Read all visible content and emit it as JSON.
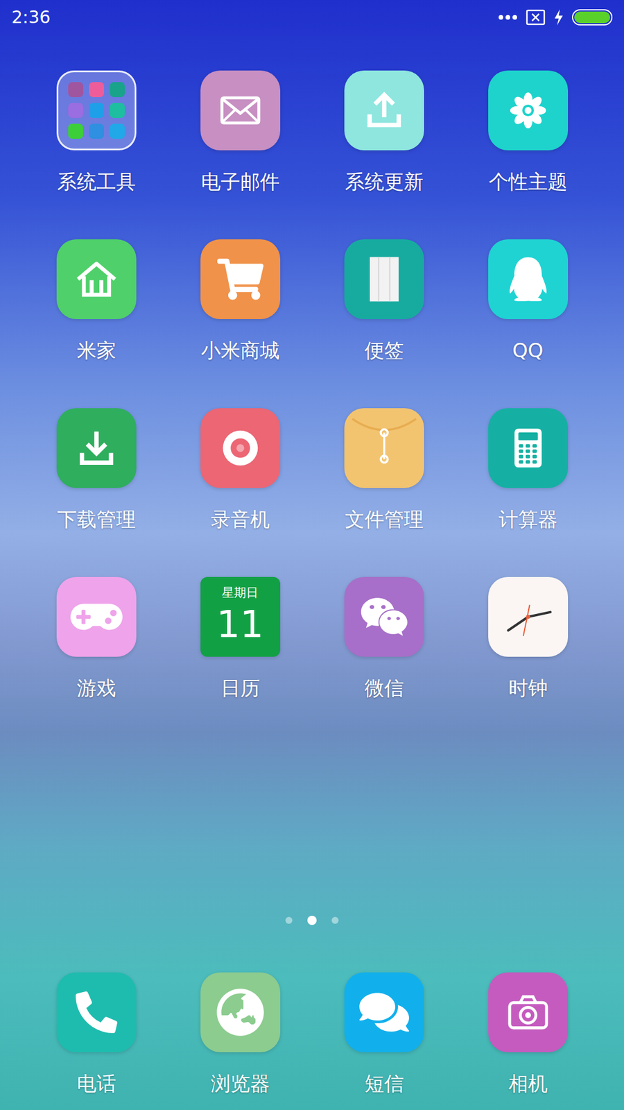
{
  "status_bar": {
    "time": "2:36",
    "battery": {
      "level": 1,
      "charging": true
    }
  },
  "apps": [
    {
      "label": "系统工具",
      "kind": "folder",
      "color": "#ffffff",
      "items": [
        {
          "color": "#a0559f"
        },
        {
          "color": "#ee5d9a"
        },
        {
          "color": "#19a38b"
        },
        {
          "color": "#9a6de0"
        },
        {
          "color": "#1ea0e8"
        },
        {
          "color": "#1dbfa0"
        },
        {
          "color": "#3ccf3a"
        },
        {
          "color": "#2f8fe0"
        },
        {
          "color": "#21a8e8"
        }
      ]
    },
    {
      "label": "电子邮件",
      "kind": "app",
      "color": "#c78fc2"
    },
    {
      "label": "系统更新",
      "kind": "app",
      "color": "#8ee6df"
    },
    {
      "label": "个性主题",
      "kind": "app",
      "color": "#1ed3cc"
    },
    {
      "label": "米家",
      "kind": "app",
      "color": "#4fd06a"
    },
    {
      "label": "小米商城",
      "kind": "app",
      "color": "#f0924a"
    },
    {
      "label": "便签",
      "kind": "app",
      "color": "#17aba0"
    },
    {
      "label": "QQ",
      "kind": "app",
      "color": "#1fd3d3"
    },
    {
      "label": "下载管理",
      "kind": "app",
      "color": "#2fae5e"
    },
    {
      "label": "录音机",
      "kind": "app",
      "color": "#ec6674"
    },
    {
      "label": "文件管理",
      "kind": "app",
      "color": "#f3c470"
    },
    {
      "label": "计算器",
      "kind": "app",
      "color": "#15b0a3"
    },
    {
      "label": "游戏",
      "kind": "app",
      "color": "#eea3ea"
    },
    {
      "label": "日历",
      "kind": "calendar",
      "color": "#12a045",
      "weekday": "星期日",
      "day": "11"
    },
    {
      "label": "微信",
      "kind": "app",
      "color": "#a76fc9"
    },
    {
      "label": "时钟",
      "kind": "clock",
      "color": "#fbf6f4"
    }
  ],
  "pages": [
    {
      "selected": false
    },
    {
      "selected": true
    },
    {
      "selected": false
    }
  ],
  "dock": [
    {
      "label": "电话",
      "kind": "app",
      "color": "#1ebcae"
    },
    {
      "label": "浏览器",
      "kind": "app",
      "color": "#8ccc8f"
    },
    {
      "label": "短信",
      "kind": "app",
      "color": "#11b0ec"
    },
    {
      "label": "相机",
      "kind": "app",
      "color": "#c55bbf"
    }
  ]
}
